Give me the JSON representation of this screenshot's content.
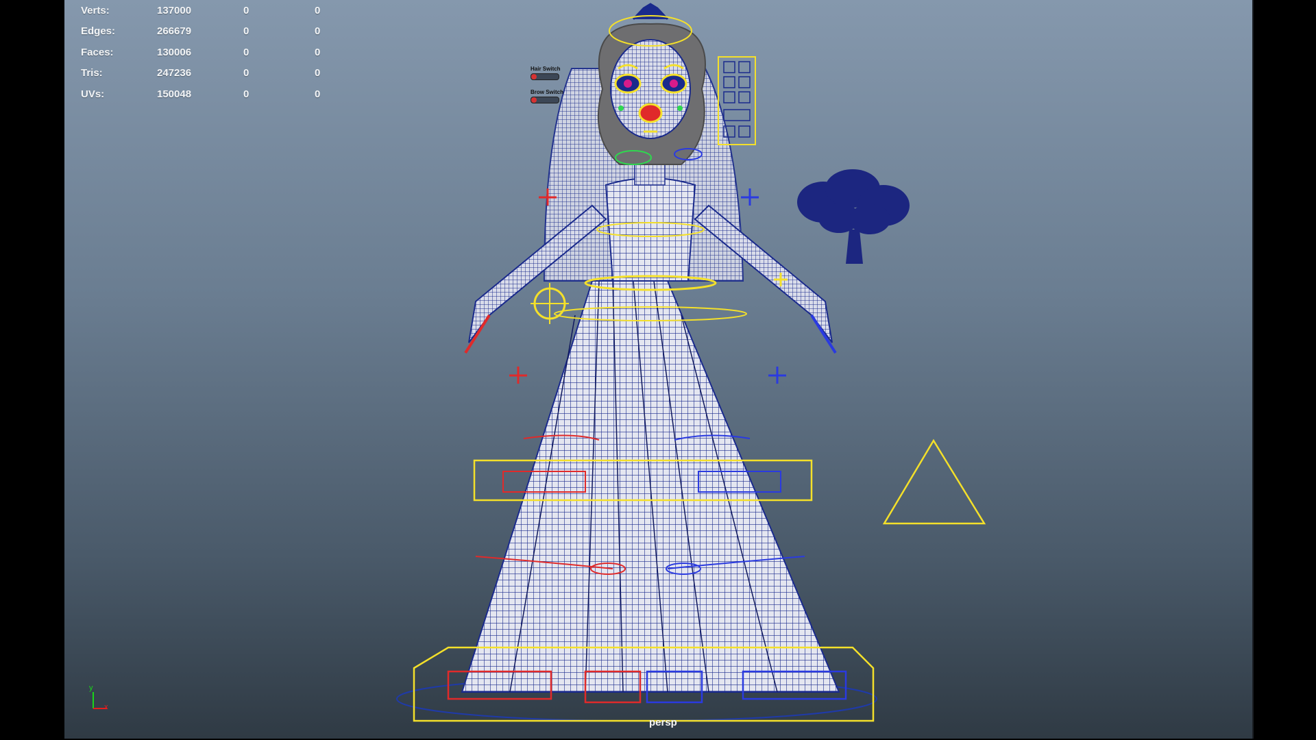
{
  "hud": {
    "rows": [
      {
        "label": "Verts:",
        "value": "137000",
        "c1": "0",
        "c2": "0"
      },
      {
        "label": "Edges:",
        "value": "266679",
        "c1": "0",
        "c2": "0"
      },
      {
        "label": "Faces:",
        "value": "130006",
        "c1": "0",
        "c2": "0"
      },
      {
        "label": "Tris:",
        "value": "247236",
        "c1": "0",
        "c2": "0"
      },
      {
        "label": "UVs:",
        "value": "150048",
        "c1": "0",
        "c2": "0"
      }
    ]
  },
  "switches": {
    "hair": {
      "label": "Hair Switch",
      "value": 0
    },
    "brow": {
      "label": "Brow Switch",
      "value": 0
    }
  },
  "camera": {
    "label": "persp"
  },
  "axis": {
    "y": "y",
    "x": "x"
  },
  "colors": {
    "wire": "#1a2a8c",
    "control_yellow": "#f4e02a",
    "control_red": "#e02a2a",
    "control_blue": "#2a3ae0",
    "control_green": "#2fd84f",
    "mesh_fill": "#e4e6f0"
  },
  "icons": {
    "tree": "tree-icon",
    "triangle": "triangle-locator-icon",
    "facial_panel": "facial-control-panel-icon",
    "axis": "axis-gizmo-icon"
  }
}
